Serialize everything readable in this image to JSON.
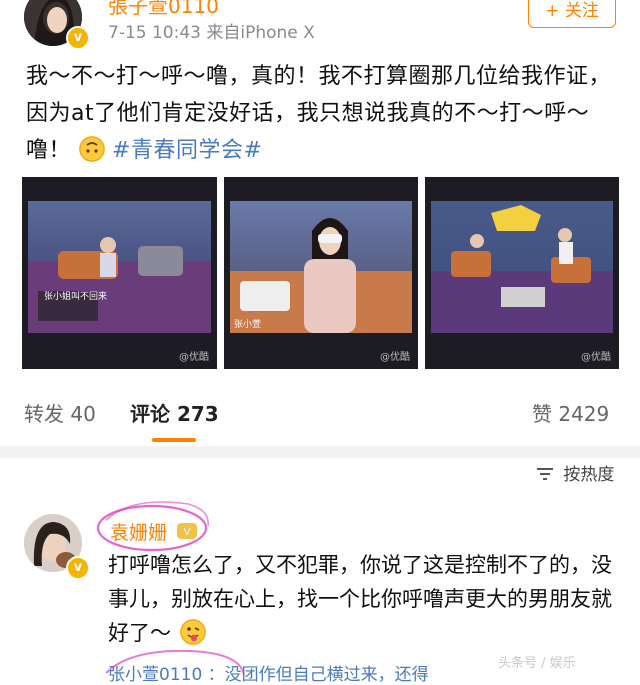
{
  "post": {
    "author": "張子萱0110",
    "meta": "7-15 10:43  来自iPhone X",
    "follow_label": "+ 关注",
    "text_main": "我～不～打～呼～噜，真的！我不打算圈那几位给我作证，因为at了他们肯定没好话，我只想说我真的不～打～呼～噜！",
    "hashtag": "#青春同学会#",
    "media": [
      {
        "watermark": "@优酷",
        "caption": "张小姐叫不回来"
      },
      {
        "watermark": "@优酷",
        "caption": "张小萱"
      },
      {
        "watermark": "@优酷",
        "caption": ""
      }
    ]
  },
  "stats": {
    "repost_label": "转发",
    "repost_count": "40",
    "comment_label": "评论",
    "comment_count": "273",
    "like_label": "赞",
    "like_count": "2429"
  },
  "comments": {
    "sort_label": "按热度",
    "items": [
      {
        "author": "袁姗姗",
        "text": "打呼噜怎么了，又不犯罪，你说了这是控制不了的，没事儿，别放在心上，找一个比你呼噜声更大的男朋友就好了～"
      }
    ],
    "reply_preview": "张小萱0110 ：没团作但自己横过来，还得"
  },
  "watermark": "头条号 / 娱乐",
  "colors": {
    "accent": "#ff8200",
    "link": "#4a7bc0",
    "highlight": "#e040c0"
  }
}
